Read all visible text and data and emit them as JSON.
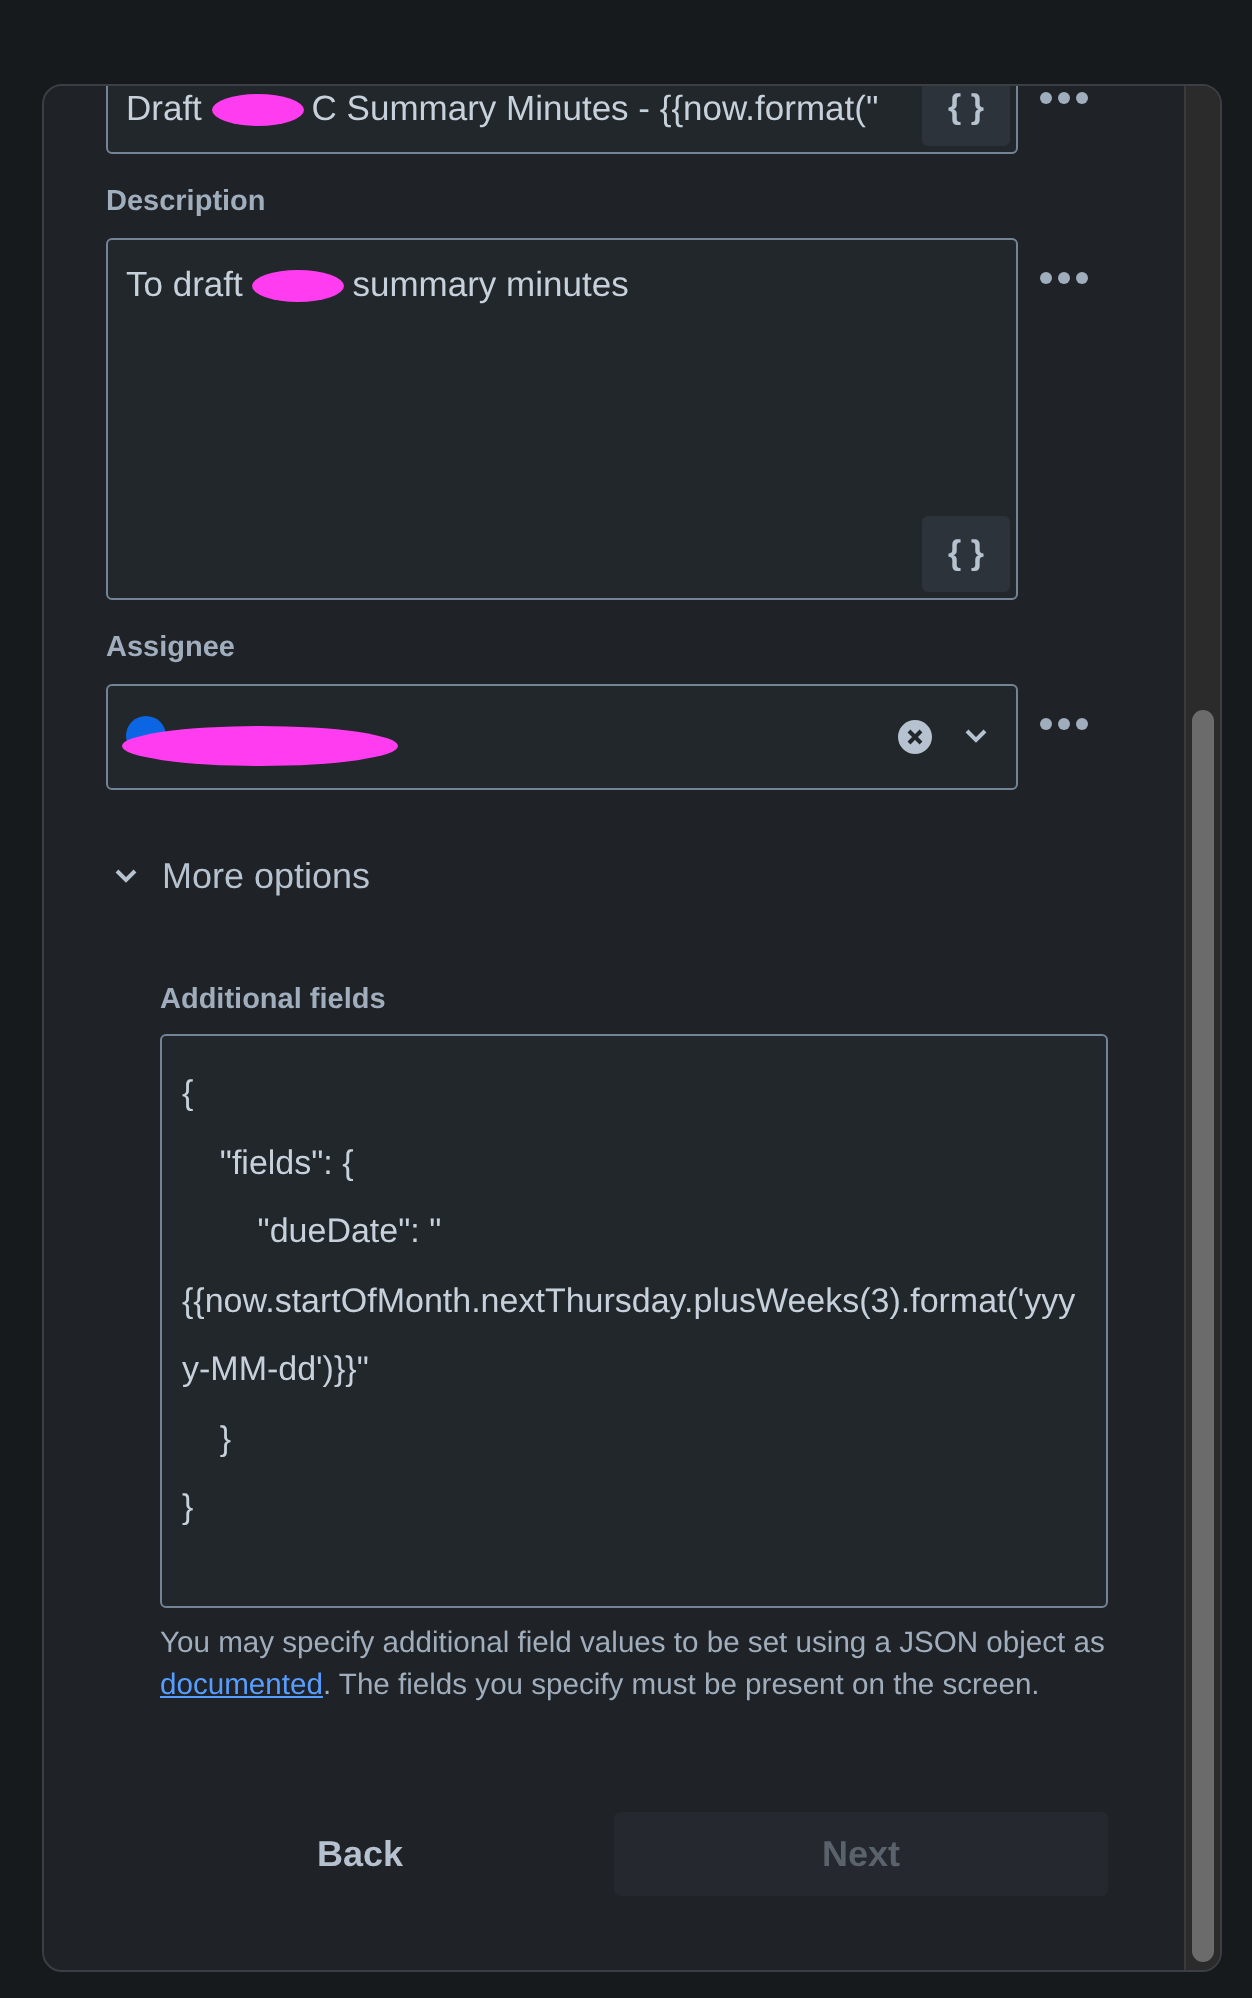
{
  "summary_field": {
    "segments": [
      {
        "kind": "text",
        "text": "Draft "
      },
      {
        "kind": "redaction"
      },
      {
        "kind": "text",
        "text": "C Summary Minutes - {{now.format(\""
      }
    ],
    "insert_button": "{ }"
  },
  "description": {
    "label": "Description",
    "segments": [
      {
        "kind": "text",
        "text": "To draft "
      },
      {
        "kind": "redaction"
      },
      {
        "kind": "text",
        "text": "summary minutes"
      }
    ],
    "insert_button": "{ }"
  },
  "assignee": {
    "label": "Assignee",
    "redacted": true
  },
  "more_options": {
    "label": "More options",
    "expanded": true
  },
  "additional_fields": {
    "label": "Additional fields",
    "value": "{\n    \"fields\": {\n        \"dueDate\": \"{{now.startOfMonth.nextThursday.plusWeeks(3).format('yyyy-MM-dd')}}\"\n    }\n}",
    "help_before": "You may specify additional field values to be set using a JSON object as ",
    "help_link": "documented",
    "help_after": ". The fields you specify must be present on the screen."
  },
  "buttons": [
    {
      "label": "Back",
      "disabled": false,
      "kind": "link"
    },
    {
      "label": "Next",
      "disabled": true,
      "kind": "primary"
    }
  ]
}
